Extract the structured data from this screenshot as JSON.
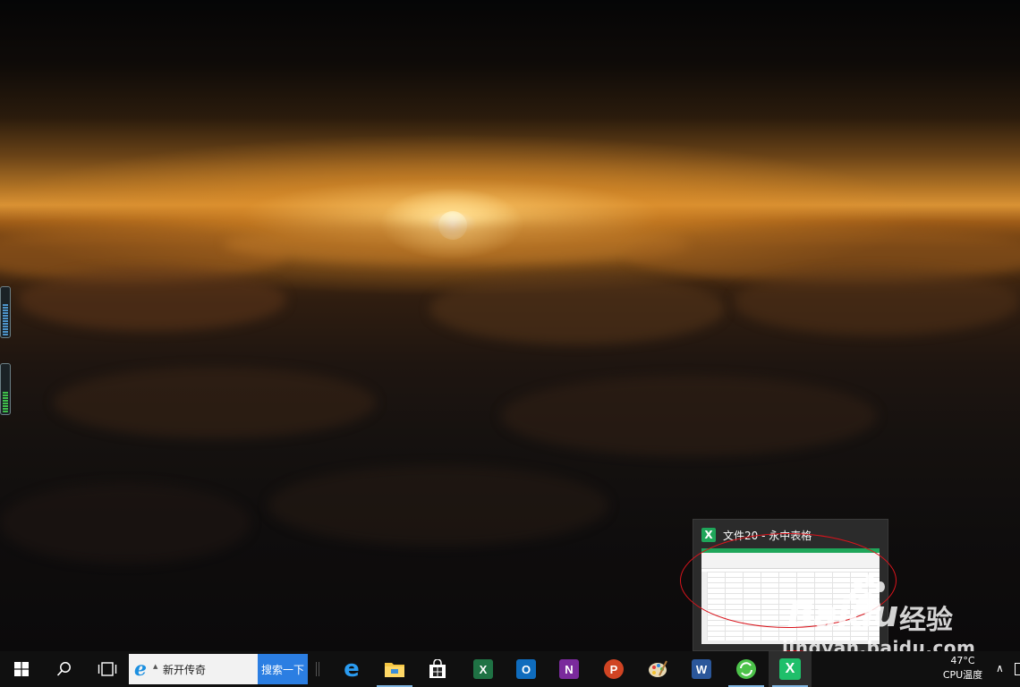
{
  "preview": {
    "title": "文件20 - 永中表格",
    "app_icon_letter": "X"
  },
  "taskbar": {
    "search_text": "新开传奇",
    "search_button": "搜索一下",
    "apps": [
      {
        "name": "edge",
        "label": "e"
      },
      {
        "name": "file-explorer",
        "label": ""
      },
      {
        "name": "store",
        "label": ""
      },
      {
        "name": "excel",
        "label": "X"
      },
      {
        "name": "outlook",
        "label": "O"
      },
      {
        "name": "onenote",
        "label": "N"
      },
      {
        "name": "powerpoint",
        "label": "P"
      },
      {
        "name": "paint",
        "label": ""
      },
      {
        "name": "word",
        "label": "W"
      },
      {
        "name": "browser",
        "label": ""
      },
      {
        "name": "yozo-sheet",
        "label": "X"
      }
    ]
  },
  "tray": {
    "temperature": "47°C",
    "temperature_label": "CPU温度"
  },
  "watermark": {
    "brand": "Baidu",
    "tag": "经验",
    "url": "jingyan.baidu.com"
  },
  "colors": {
    "taskbar": "#101010",
    "search_button": "#2b7ee2",
    "annotation": "#d9141c",
    "yozo_green": "#1fa65a"
  }
}
